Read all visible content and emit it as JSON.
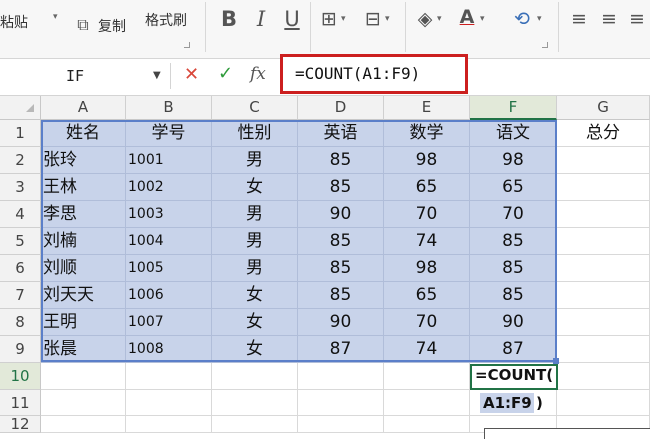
{
  "ribbon": {
    "paste_label": "粘贴",
    "copy_label": "复制",
    "format_painter_label": "格式刷",
    "bold_glyph": "B",
    "italic_glyph": "I",
    "underline_glyph": "U"
  },
  "formula_bar": {
    "name_box": "IF",
    "fx_label": "fx",
    "formula": "=COUNT(A1:F9)"
  },
  "columns": [
    "A",
    "B",
    "C",
    "D",
    "E",
    "F",
    "G"
  ],
  "active_column": "F",
  "rows": [
    "1",
    "2",
    "3",
    "4",
    "5",
    "6",
    "7",
    "8",
    "9",
    "10",
    "11",
    "12"
  ],
  "active_row": "10",
  "cells": [
    [
      "姓名",
      "学号",
      "性别",
      "英语",
      "数学",
      "语文",
      "总分"
    ],
    [
      "张玲",
      "1001",
      "男",
      "85",
      "98",
      "98",
      ""
    ],
    [
      "王林",
      "1002",
      "女",
      "85",
      "65",
      "65",
      ""
    ],
    [
      "李思",
      "1003",
      "男",
      "90",
      "70",
      "70",
      ""
    ],
    [
      "刘楠",
      "1004",
      "男",
      "85",
      "74",
      "85",
      ""
    ],
    [
      "刘顺",
      "1005",
      "男",
      "85",
      "98",
      "85",
      ""
    ],
    [
      "刘天天",
      "1006",
      "女",
      "85",
      "65",
      "85",
      ""
    ],
    [
      "王明",
      "1007",
      "女",
      "90",
      "70",
      "90",
      ""
    ],
    [
      "张晨",
      "1008",
      "女",
      "87",
      "74",
      "87",
      ""
    ]
  ],
  "editing": {
    "line1": "=COUNT(",
    "ref": "A1:F9",
    "close": ")"
  },
  "colors": {
    "selection": "#c8d3ea",
    "selection_border": "#5b7fc9",
    "active_header": "#217346",
    "highlight_box": "#cc1f1f"
  }
}
